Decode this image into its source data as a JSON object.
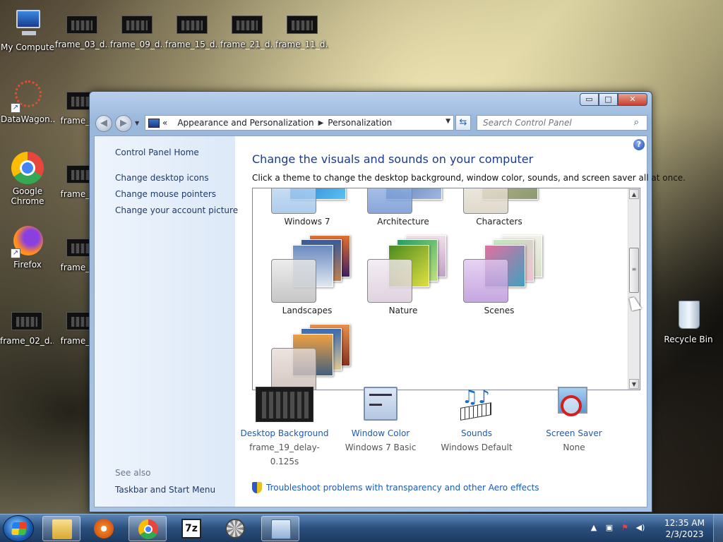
{
  "desktop": {
    "icons": [
      {
        "label": "My Computer"
      },
      {
        "label": "frame_03_d..."
      },
      {
        "label": "frame_09_d..."
      },
      {
        "label": "frame_15_d..."
      },
      {
        "label": "frame_21_d..."
      },
      {
        "label": "frame_11_d..."
      },
      {
        "label": "DataWagon..."
      },
      {
        "label": "frame_0..."
      },
      {
        "label": "Google Chrome"
      },
      {
        "label": "frame_0..."
      },
      {
        "label": "Firefox"
      },
      {
        "label": "frame_0..."
      },
      {
        "label": "frame_02_d..."
      },
      {
        "label": "frame_0..."
      },
      {
        "label": "Recycle Bin"
      }
    ]
  },
  "window": {
    "caption_buttons": {
      "minimize": "▭",
      "maximize": "□",
      "close": "✕"
    },
    "address": {
      "prefix": "«",
      "crumbs": [
        "Appearance and Personalization",
        "Personalization"
      ]
    },
    "search_placeholder": "Search Control Panel",
    "left_pane": {
      "home": "Control Panel Home",
      "links": [
        "Change desktop icons",
        "Change mouse pointers",
        "Change your account picture"
      ],
      "see_also": "See also",
      "see_also_links": [
        "Taskbar and Start Menu"
      ]
    },
    "title": "Change the visuals and sounds on your computer",
    "subtitle": "Click a theme to change the desktop background, window color, sounds, and screen saver all at once.",
    "themes": [
      "Windows 7",
      "Architecture",
      "Characters",
      "Landscapes",
      "Nature",
      "Scenes"
    ],
    "bottom": [
      {
        "link": "Desktop Background",
        "value": "frame_19_delay-0.125s"
      },
      {
        "link": "Window Color",
        "value": "Windows 7 Basic"
      },
      {
        "link": "Sounds",
        "value": "Windows Default"
      },
      {
        "link": "Screen Saver",
        "value": "None"
      }
    ],
    "troubleshoot": "Troubleshoot problems with transparency and other Aero effects"
  },
  "taskbar": {
    "clock_time": "12:35 AM",
    "clock_date": "2/3/2023"
  }
}
